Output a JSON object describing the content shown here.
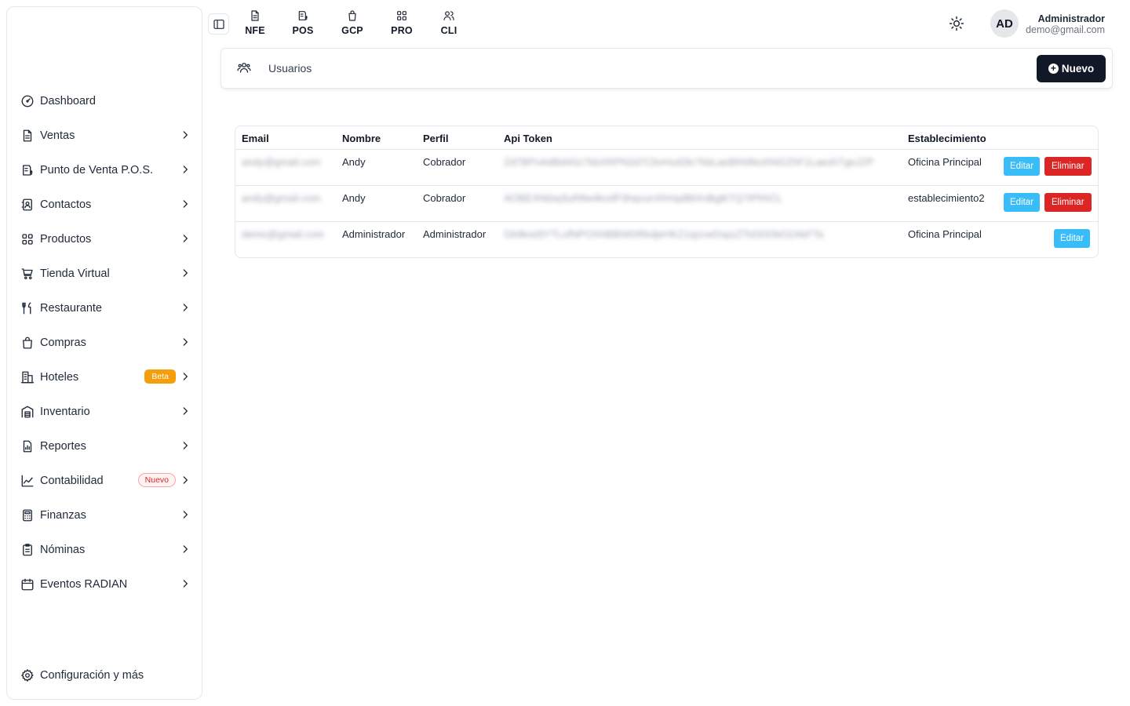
{
  "sidebar": {
    "items": [
      {
        "label": "Dashboard",
        "icon": "dashboard-icon",
        "chevron": false
      },
      {
        "label": "Ventas",
        "icon": "document-icon",
        "chevron": true
      },
      {
        "label": "Punto de Venta P.O.S.",
        "icon": "pos-icon",
        "chevron": true
      },
      {
        "label": "Contactos",
        "icon": "contacts-icon",
        "chevron": true
      },
      {
        "label": "Productos",
        "icon": "grid-icon",
        "chevron": true
      },
      {
        "label": "Tienda Virtual",
        "icon": "cart-icon",
        "chevron": true
      },
      {
        "label": "Restaurante",
        "icon": "utensils-icon",
        "chevron": true
      },
      {
        "label": "Compras",
        "icon": "shopping-bag-icon",
        "chevron": true
      },
      {
        "label": "Hoteles",
        "icon": "building-icon",
        "chevron": true,
        "badge": "Beta"
      },
      {
        "label": "Inventario",
        "icon": "warehouse-icon",
        "chevron": true
      },
      {
        "label": "Reportes",
        "icon": "report-icon",
        "chevron": true
      },
      {
        "label": "Contabilidad",
        "icon": "chart-icon",
        "chevron": true,
        "badge": "Nuevo"
      },
      {
        "label": "Finanzas",
        "icon": "calculator-icon",
        "chevron": true
      },
      {
        "label": "Nóminas",
        "icon": "clipboard-icon",
        "chevron": true
      },
      {
        "label": "Eventos RADIAN",
        "icon": "calendar-icon",
        "chevron": true
      }
    ],
    "config_label": "Configuración y más"
  },
  "topbar": {
    "modules": [
      {
        "label": "NFE",
        "icon": "file-icon"
      },
      {
        "label": "POS",
        "icon": "pos-icon"
      },
      {
        "label": "GCP",
        "icon": "bag-icon"
      },
      {
        "label": "PRO",
        "icon": "grid-icon"
      },
      {
        "label": "CLI",
        "icon": "users-icon"
      }
    ],
    "avatar_initials": "AD",
    "user_name": "Administrador",
    "user_email": "demo@gmail.com"
  },
  "page": {
    "title": "Usuarios",
    "new_button": "Nuevo"
  },
  "table": {
    "columns": [
      "Email",
      "Nombre",
      "Perfil",
      "Api Token",
      "Establecimiento"
    ],
    "rows": [
      {
        "email": "andy@gmail.com",
        "nombre": "Andy",
        "perfil": "Cobrador",
        "token": "Zd7BPnAdBd4Sz7kbXRPN2d7CbvHxd2kr7kbLaeBhN8ezhNGZhF1LaeshTgeJZP",
        "establecimiento": "Oficina Principal",
        "edit": "Editar",
        "delete": "Eliminar"
      },
      {
        "email": "andy@gmail.com",
        "nombre": "Andy",
        "perfil": "Cobrador",
        "token": "AOBEXhkbq3uR8w4kvdP3hqvunXhHqdBtXnBgtkTQ7tPhhCL",
        "establecimiento": "establecimiento2",
        "edit": "Editar",
        "delete": "Eliminar"
      },
      {
        "email": "demo@gmail.com",
        "nombre": "Administrador",
        "perfil": "Administrador",
        "token": "Gk9ksd3YTLxfNPOXNBBWDRkdjeHKZ1qzcwDspzZTsDDDbOZAkFTa",
        "establecimiento": "Oficina Principal",
        "edit": "Editar"
      }
    ]
  },
  "colors": {
    "primary_dark": "#111827",
    "edit_button": "#38bdf8",
    "delete_button": "#dc2626",
    "beta_badge": "#f59e0b"
  }
}
